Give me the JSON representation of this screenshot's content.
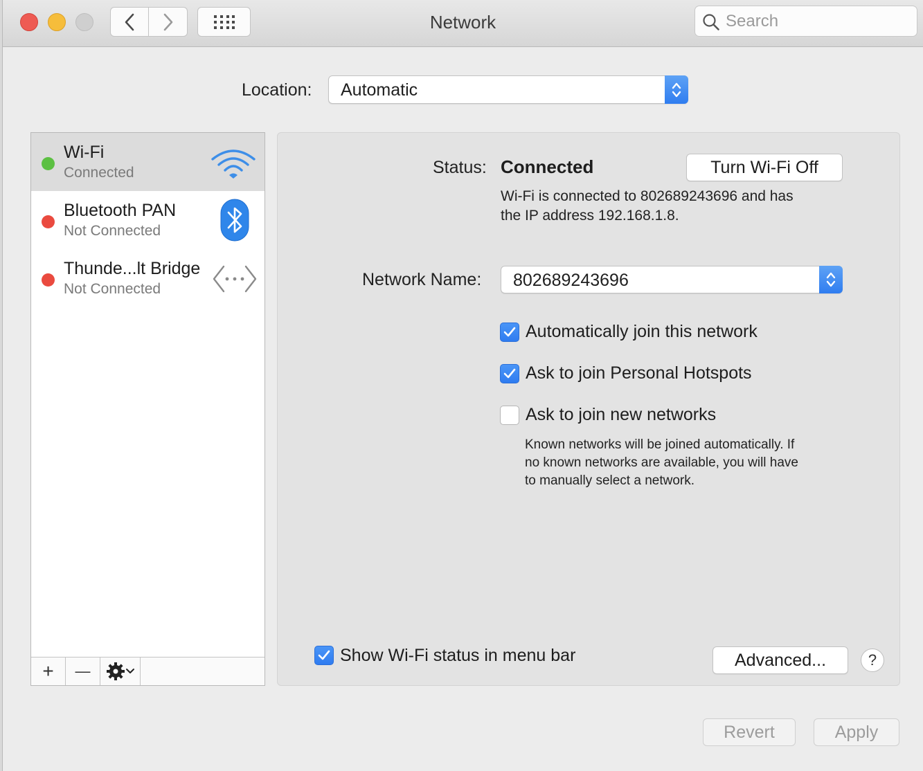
{
  "window": {
    "title": "Network",
    "search_placeholder": "Search"
  },
  "location": {
    "label": "Location:",
    "value": "Automatic"
  },
  "services": [
    {
      "name": "Wi-Fi",
      "status": "Connected",
      "dot_color": "#5cc042",
      "icon": "wifi-icon"
    },
    {
      "name": "Bluetooth PAN",
      "status": "Not Connected",
      "dot_color": "#ea4a3f",
      "icon": "bluetooth-icon"
    },
    {
      "name": "Thunde...lt Bridge",
      "status": "Not Connected",
      "dot_color": "#ea4a3f",
      "icon": "thunderbolt-bridge-icon"
    }
  ],
  "sidebar_toolbar": {
    "add": "+",
    "remove": "—"
  },
  "detail": {
    "status_label": "Status:",
    "status_value": "Connected",
    "turn_off_label": "Turn Wi-Fi Off",
    "status_desc_1": "Wi-Fi is connected to 802689243696 and has",
    "status_desc_2": "the IP address 192.168.1.8.",
    "network_name_label": "Network Name:",
    "network_name_value": "802689243696",
    "checkboxes": [
      {
        "label": "Automatically join this network",
        "checked": true
      },
      {
        "label": "Ask to join Personal Hotspots",
        "checked": true
      },
      {
        "label": "Ask to join new networks",
        "checked": false
      }
    ],
    "note_1": "Known networks will be joined automatically. If",
    "note_2": "no known networks are available, you will have",
    "note_3": "to manually select a network.",
    "show_status_label": "Show Wi-Fi status in menu bar",
    "show_status_checked": true,
    "advanced_label": "Advanced...",
    "help_label": "?"
  },
  "footer": {
    "revert_label": "Revert",
    "apply_label": "Apply"
  },
  "colors": {
    "accent": "#2f7df0",
    "connected": "#5cc042",
    "not_connected": "#ea4a3f"
  }
}
